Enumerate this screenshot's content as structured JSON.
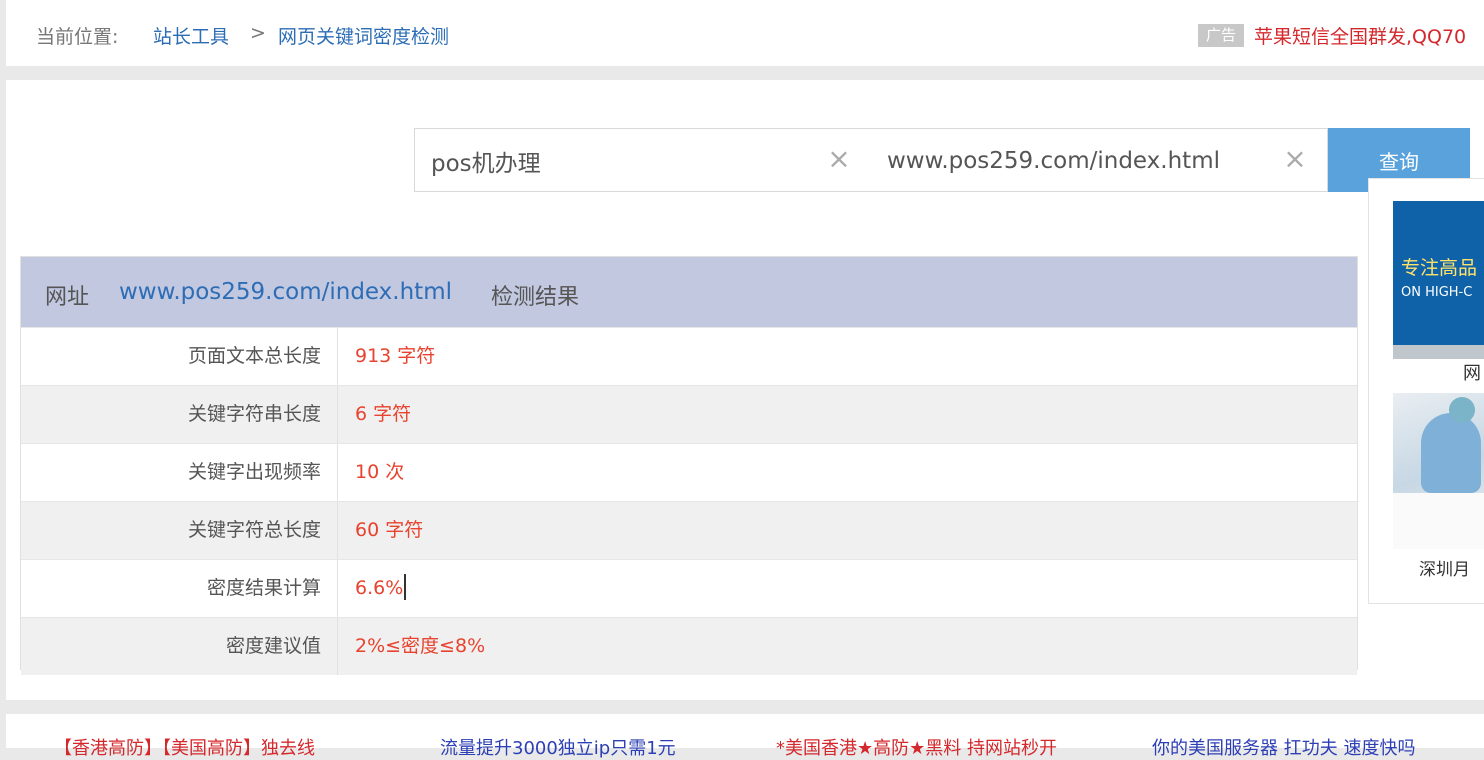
{
  "breadcrumb": {
    "label": "当前位置:",
    "link1": "站长工具",
    "separator": ">",
    "link2": "网页关键词密度检测"
  },
  "ad": {
    "tag": "广告",
    "text": "苹果短信全国群发,QQ70"
  },
  "search": {
    "keyword_value": "pos机办理",
    "url_value": "www.pos259.com/index.html",
    "button": "查询"
  },
  "result": {
    "head_label": "网址",
    "head_url": "www.pos259.com/index.html",
    "head_suffix": "检测结果",
    "rows": [
      {
        "label": "页面文本总长度",
        "value": "913 字符"
      },
      {
        "label": "关键字符串长度",
        "value": "6 字符"
      },
      {
        "label": "关键字出现频率",
        "value": "10 次"
      },
      {
        "label": "关键字符总长度",
        "value": "60 字符"
      },
      {
        "label": "密度结果计算",
        "value": "6.6%"
      },
      {
        "label": "密度建议值",
        "value": "2%≤密度≤8%"
      }
    ]
  },
  "side": {
    "ad1_text1": "专注高品",
    "ad1_text2": "ON HIGH-C",
    "ad1_caption": "网",
    "ad2_caption": "深圳月"
  },
  "footer": {
    "link1": "【香港高防】【美国高防】独去线",
    "link2": "流量提升3000独立ip只需1元",
    "link3": "*美国香港★高防★黑料 持网站秒开",
    "link4": "你的美国服务器 扛功夫 速度快吗"
  },
  "colors": {
    "accent": "#5aa2dc",
    "link": "#2d6db5",
    "value_red": "#e8432e",
    "header_bg": "#c2c8e0"
  }
}
